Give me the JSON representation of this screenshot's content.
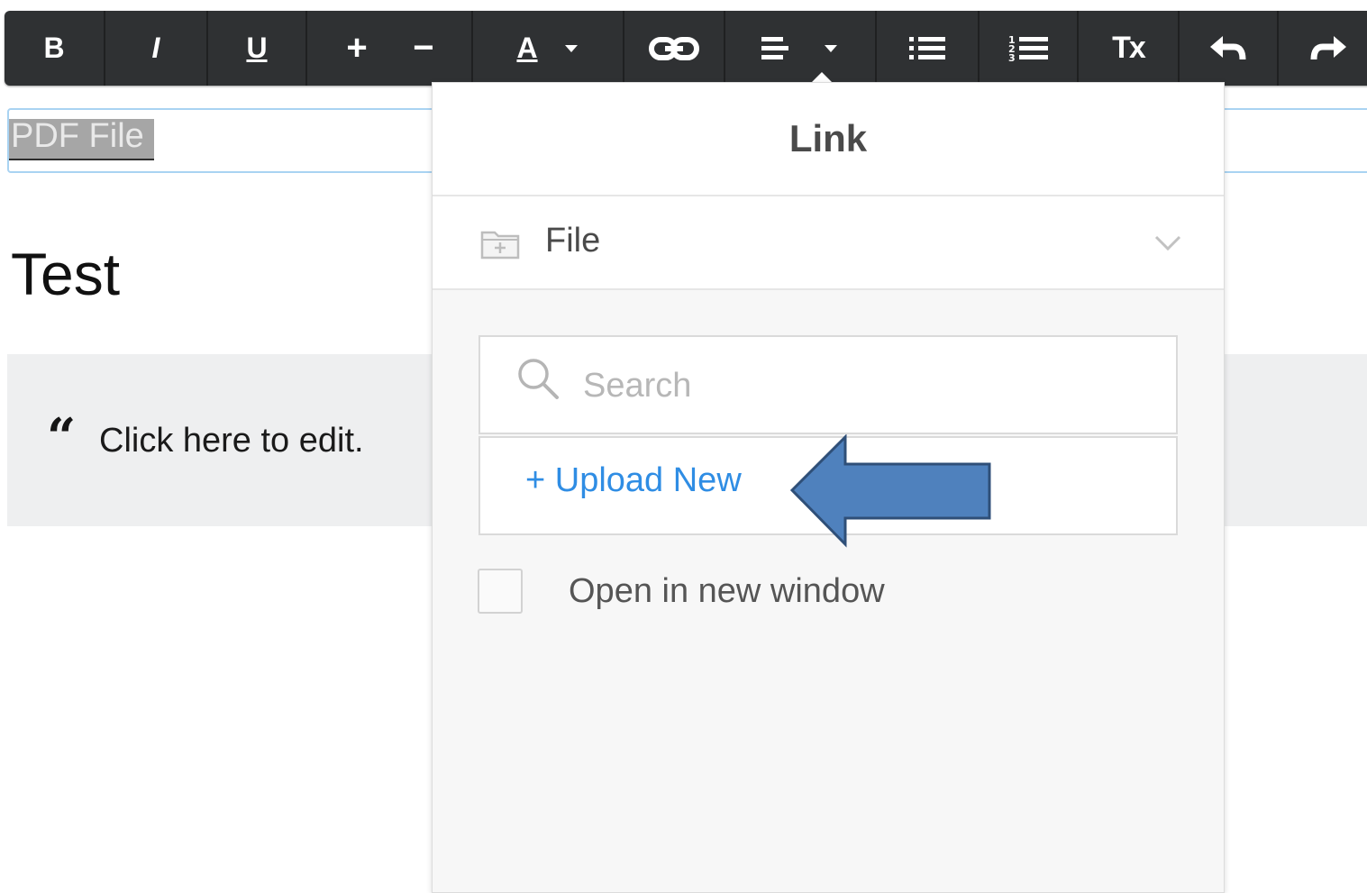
{
  "toolbar": {
    "buttons": [
      {
        "name": "bold",
        "label": "B"
      },
      {
        "name": "italic",
        "label": "I"
      },
      {
        "name": "underline",
        "label": "U"
      },
      {
        "name": "increase-font-size",
        "label": "+"
      },
      {
        "name": "decrease-font-size",
        "label": "−"
      },
      {
        "name": "text-color",
        "label": "A"
      },
      {
        "name": "link",
        "icon": "link-icon"
      },
      {
        "name": "align",
        "icon": "align-left-icon"
      },
      {
        "name": "bullet-list",
        "icon": "bulleted-list-icon"
      },
      {
        "name": "numbered-list",
        "icon": "numbered-list-icon"
      },
      {
        "name": "clear-format",
        "label": "Tx"
      },
      {
        "name": "undo",
        "icon": "undo-icon"
      },
      {
        "name": "redo",
        "icon": "redo-icon"
      }
    ]
  },
  "editor": {
    "title_field_text": "PDF File",
    "heading": "Test",
    "quote_mark": "“",
    "quote_text": "Click here to edit."
  },
  "link_popup": {
    "title": "Link",
    "link_type": {
      "label": "File",
      "icon": "folder-icon"
    },
    "search": {
      "placeholder": "Search",
      "value": ""
    },
    "upload": {
      "plus": "+",
      "label": "Upload New"
    },
    "open_new_window": {
      "label": "Open in new window",
      "checked": false
    }
  },
  "colors": {
    "toolbar_bg": "#2f3133",
    "link_blue": "#2f8de4",
    "annotation_arrow": "#4f81bd"
  }
}
